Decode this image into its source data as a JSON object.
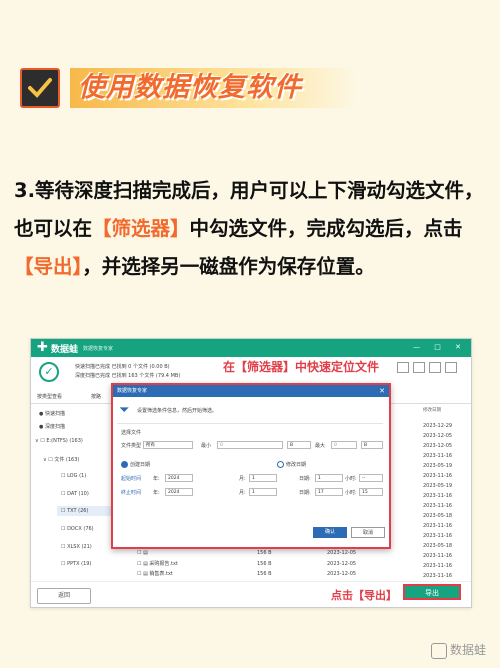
{
  "header": {
    "title": "使用数据恢复软件"
  },
  "step": {
    "part1": "3.等待深度扫描完成后，用户可以上下滑动勾选文件，也可以在",
    "filter_label": "【筛选器】",
    "part2": "中勾选文件，完成勾选后，点击",
    "export_label": "【导出】",
    "part3": "，并选择另一磁盘作为保存位置。"
  },
  "app": {
    "name": "数据蛙",
    "subtitle": "数据恢复专家",
    "scan_line1": "快速扫描已完成 已找到 0 个文件 (0.00 B)",
    "scan_line2": "深度扫描已完成 已找到 163 个文件 (79.4 MB)",
    "tab_type": "按类型查看",
    "tab_path": "按路",
    "col_modified": "修改日期",
    "back_label": "返回",
    "export_label": "导出"
  },
  "tree": [
    {
      "label": "快速扫描",
      "checked": false
    },
    {
      "label": "深度扫描",
      "checked": false
    },
    {
      "label": "E:(NTFS) (163)",
      "checked": false
    },
    {
      "label": "文件 (163)",
      "checked": false
    },
    {
      "label": "LOG (1)",
      "checked": false
    },
    {
      "label": "DAT (10)",
      "checked": false
    },
    {
      "label": "TXT (26)",
      "checked": false
    },
    {
      "label": "DOCX (76)",
      "checked": false
    },
    {
      "label": "XLSX (21)",
      "checked": false
    },
    {
      "label": "PPTX (19)",
      "checked": false
    }
  ],
  "files": [
    {
      "name": "采购报告.txt",
      "size": "156 B",
      "date": "2023-12-05"
    },
    {
      "name": "销售表.txt",
      "size": "156 B",
      "date": "2023-12-05"
    },
    {
      "name": "",
      "size": "156 B",
      "date": "2023-12-05"
    }
  ],
  "dates": [
    "2023-12-29",
    "2023-12-05",
    "2023-12-05",
    "2023-11-16",
    "2023-05-19",
    "2023-11-16",
    "2023-05-19",
    "2023-11-16",
    "2023-11-16",
    "2023-05-18",
    "2023-11-16",
    "2023-11-16",
    "2023-05-18",
    "2023-11-16",
    "2023-11-16",
    "2023-11-16",
    "2023-11-16"
  ],
  "dialog": {
    "title": "数据恢复专家",
    "hint": "设置筛选条件信息，然后开始筛选。",
    "section": "选择文件",
    "file_type_label": "文件类型",
    "file_type_value": "所有",
    "min_label": "最小",
    "min_placeholder": "0",
    "min_unit": "B",
    "max_label": "最大",
    "max_placeholder": "0",
    "max_unit": "B",
    "create_date": "创建日期",
    "modify_date": "修改日期",
    "start_label": "起始时间",
    "end_label": "终止时间",
    "year_label": "年:",
    "month_label": "月:",
    "day_label": "日期:",
    "hour_label": "小时:",
    "start_year": "2024",
    "start_month": "1",
    "start_day": "1",
    "start_hour": "--",
    "end_year": "2024",
    "end_month": "1",
    "end_day": "17",
    "end_hour": "15",
    "ok_label": "确认",
    "cancel_label": "取消"
  },
  "annotations": {
    "top": "在【筛选器】中快速定位文件",
    "bottom": "点击【导出】"
  },
  "watermark": "数据蛙",
  "colors": {
    "brand": "#16a37f",
    "accent": "#f26b2e",
    "annotation": "#e23e4a",
    "dialog_blue": "#2d6bb5"
  }
}
